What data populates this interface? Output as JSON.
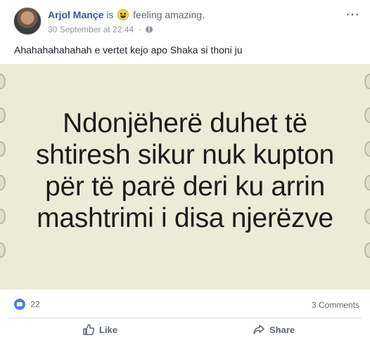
{
  "post": {
    "author": "Arjol Mançe",
    "is_text": "is",
    "feeling_text": "feeling amazing.",
    "timestamp": "30 September at 22:44",
    "separator": "·",
    "more_icon": "⋯",
    "text": "Ahahahahahahah e vertet kejo apo Shaka si thoni ju"
  },
  "image": {
    "quote_lines": [
      "Ndonjëherë duhet të",
      "shtiresh sikur nuk kupton",
      "për të parë deri ku arrin",
      "mashtrimi i disa njerëzve"
    ]
  },
  "stats": {
    "likes": "22",
    "comments": "3 Comments"
  },
  "actions": {
    "like_label": "Like",
    "share_label": "Share"
  },
  "colors": {
    "author": "#365899",
    "reaction_blue": "#4a7cf2",
    "image_bg": "#ecebd8"
  }
}
